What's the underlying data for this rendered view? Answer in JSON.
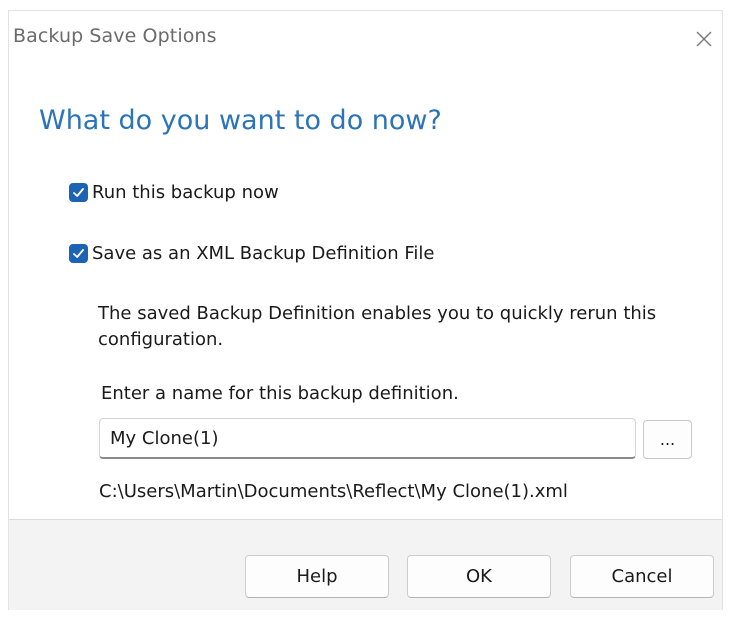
{
  "window": {
    "title": "Backup Save Options"
  },
  "heading": "What do you want to do now?",
  "options": {
    "run_now": {
      "label": "Run this backup now",
      "checked": true
    },
    "save_xml": {
      "label": "Save as an XML Backup Definition File",
      "checked": true
    }
  },
  "description": "The saved Backup Definition enables you to quickly rerun this configuration.",
  "name_prompt": "Enter a name for this backup definition.",
  "name_input": {
    "value": "My Clone(1)"
  },
  "browse_label": "...",
  "file_path": "C:\\Users\\Martin\\Documents\\Reflect\\My Clone(1).xml",
  "buttons": {
    "help": "Help",
    "ok": "OK",
    "cancel": "Cancel"
  },
  "colors": {
    "heading": "#2c74b8",
    "checkbox": "#1d63b3",
    "footer_bg": "#f3f3f3"
  },
  "icons": {
    "close": "close-icon",
    "check": "checkmark-icon"
  }
}
